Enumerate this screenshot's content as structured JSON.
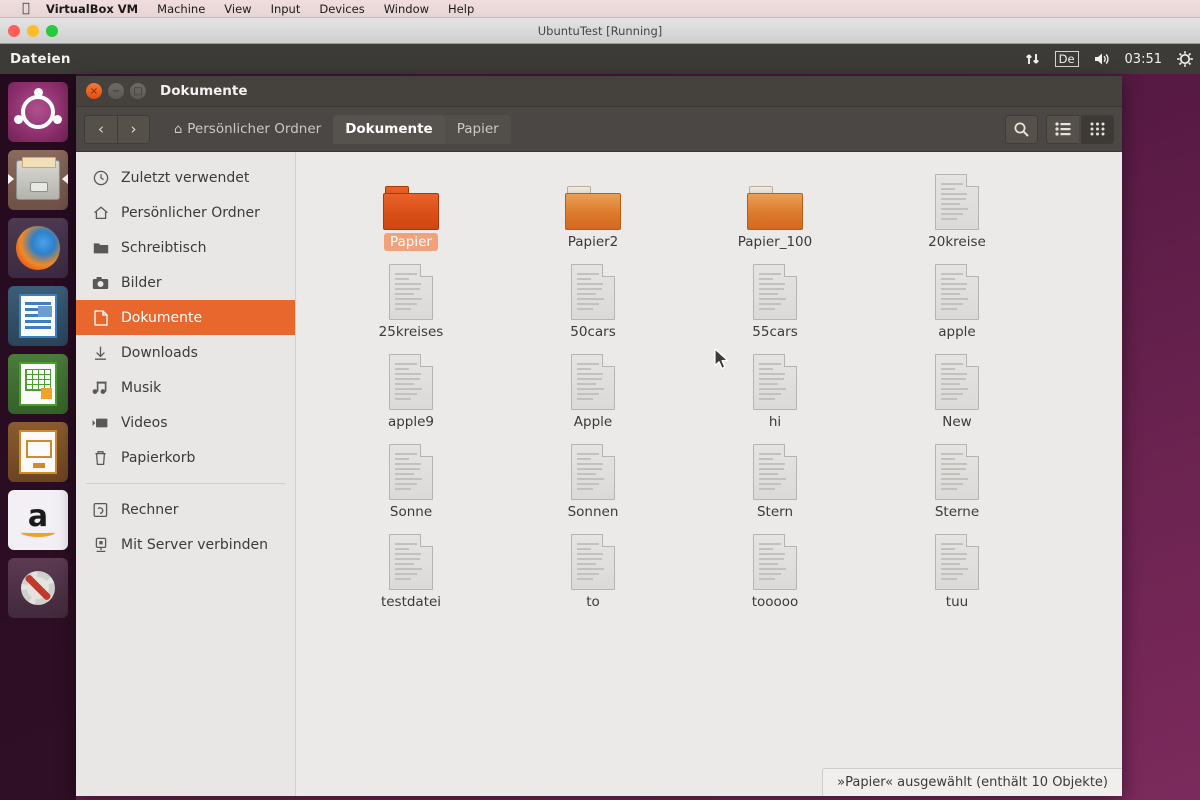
{
  "host_menubar": {
    "apple_glyph": "apple-logo",
    "items": [
      {
        "label": "VirtualBox VM",
        "bold": true
      },
      {
        "label": "Machine",
        "bold": false
      },
      {
        "label": "View",
        "bold": false
      },
      {
        "label": "Input",
        "bold": false
      },
      {
        "label": "Devices",
        "bold": false
      },
      {
        "label": "Window",
        "bold": false
      },
      {
        "label": "Help",
        "bold": false
      }
    ]
  },
  "vbox_window": {
    "title": "UbuntuTest [Running]"
  },
  "unity_panel": {
    "app_name": "Dateien",
    "indicators": {
      "network": "↑↓",
      "keyboard": "De",
      "volume": "volume-icon",
      "clock": "03:51",
      "session": "gear-icon"
    }
  },
  "launcher": {
    "items": [
      {
        "name": "ubuntu-dash",
        "label": "Ubuntu Dash"
      },
      {
        "name": "files",
        "label": "Dateien",
        "running": true
      },
      {
        "name": "firefox",
        "label": "Firefox"
      },
      {
        "name": "libreoffice-writer",
        "label": "LibreOffice Writer"
      },
      {
        "name": "libreoffice-calc",
        "label": "LibreOffice Calc"
      },
      {
        "name": "libreoffice-impress",
        "label": "LibreOffice Impress"
      },
      {
        "name": "amazon",
        "label": "Amazon"
      },
      {
        "name": "system-settings",
        "label": "Systemeinstellungen"
      }
    ]
  },
  "nautilus": {
    "title": "Dokumente",
    "window_buttons": {
      "close": "×",
      "minimize": "−",
      "maximize": "□"
    },
    "nav": {
      "back": "‹",
      "forward": "›"
    },
    "breadcrumb": [
      {
        "label": "Persönlicher Ordner",
        "icon": "home-icon",
        "state": "normal"
      },
      {
        "label": "Dokumente",
        "icon": "",
        "state": "active"
      },
      {
        "label": "Papier",
        "icon": "",
        "state": "tail"
      }
    ],
    "toolbar_right": [
      {
        "name": "search-icon",
        "glyph": "⚲"
      },
      {
        "name": "list-view-icon",
        "glyph": "list"
      },
      {
        "name": "grid-view-icon",
        "glyph": "grid",
        "active": true
      }
    ],
    "sidebar": {
      "items": [
        {
          "label": "Zuletzt verwendet",
          "icon": "clock-icon",
          "selected": false
        },
        {
          "label": "Persönlicher Ordner",
          "icon": "home-icon",
          "selected": false
        },
        {
          "label": "Schreibtisch",
          "icon": "folder-icon",
          "selected": false
        },
        {
          "label": "Bilder",
          "icon": "camera-icon",
          "selected": false
        },
        {
          "label": "Dokumente",
          "icon": "document-icon",
          "selected": true
        },
        {
          "label": "Downloads",
          "icon": "download-icon",
          "selected": false
        },
        {
          "label": "Musik",
          "icon": "music-icon",
          "selected": false
        },
        {
          "label": "Videos",
          "icon": "video-icon",
          "selected": false
        },
        {
          "label": "Papierkorb",
          "icon": "trash-icon",
          "selected": false
        }
      ],
      "items2": [
        {
          "label": "Rechner",
          "icon": "computer-icon",
          "selected": false
        },
        {
          "label": "Mit Server verbinden",
          "icon": "server-icon",
          "selected": false
        }
      ]
    },
    "files": [
      {
        "name": "Papier",
        "type": "folder",
        "selected": true
      },
      {
        "name": "Papier2",
        "type": "folder",
        "selected": false
      },
      {
        "name": "Papier_100",
        "type": "folder",
        "selected": false
      },
      {
        "name": "20kreise",
        "type": "document",
        "selected": false
      },
      {
        "name": "25kreises",
        "type": "document",
        "selected": false
      },
      {
        "name": "50cars",
        "type": "document",
        "selected": false
      },
      {
        "name": "55cars",
        "type": "document",
        "selected": false
      },
      {
        "name": "apple",
        "type": "document",
        "selected": false
      },
      {
        "name": "apple9",
        "type": "document",
        "selected": false
      },
      {
        "name": "Apple",
        "type": "document",
        "selected": false
      },
      {
        "name": "hi",
        "type": "document",
        "selected": false
      },
      {
        "name": "New",
        "type": "document",
        "selected": false
      },
      {
        "name": "Sonne",
        "type": "document",
        "selected": false
      },
      {
        "name": "Sonnen",
        "type": "document",
        "selected": false
      },
      {
        "name": "Stern",
        "type": "document",
        "selected": false
      },
      {
        "name": "Sterne",
        "type": "document",
        "selected": false
      },
      {
        "name": "testdatei",
        "type": "document",
        "selected": false
      },
      {
        "name": "to",
        "type": "document",
        "selected": false
      },
      {
        "name": "tooooo",
        "type": "document",
        "selected": false
      },
      {
        "name": "tuu",
        "type": "document",
        "selected": false
      }
    ],
    "statusbar": "»Papier« ausgewählt  (enthält 10 Objekte)"
  },
  "colors": {
    "accent_orange": "#e8672c",
    "panel_dark": "#3c3b37",
    "titlebar": "#45423e",
    "desktop_purple": "#5d1f47",
    "selection_label": "#f2a27a"
  }
}
